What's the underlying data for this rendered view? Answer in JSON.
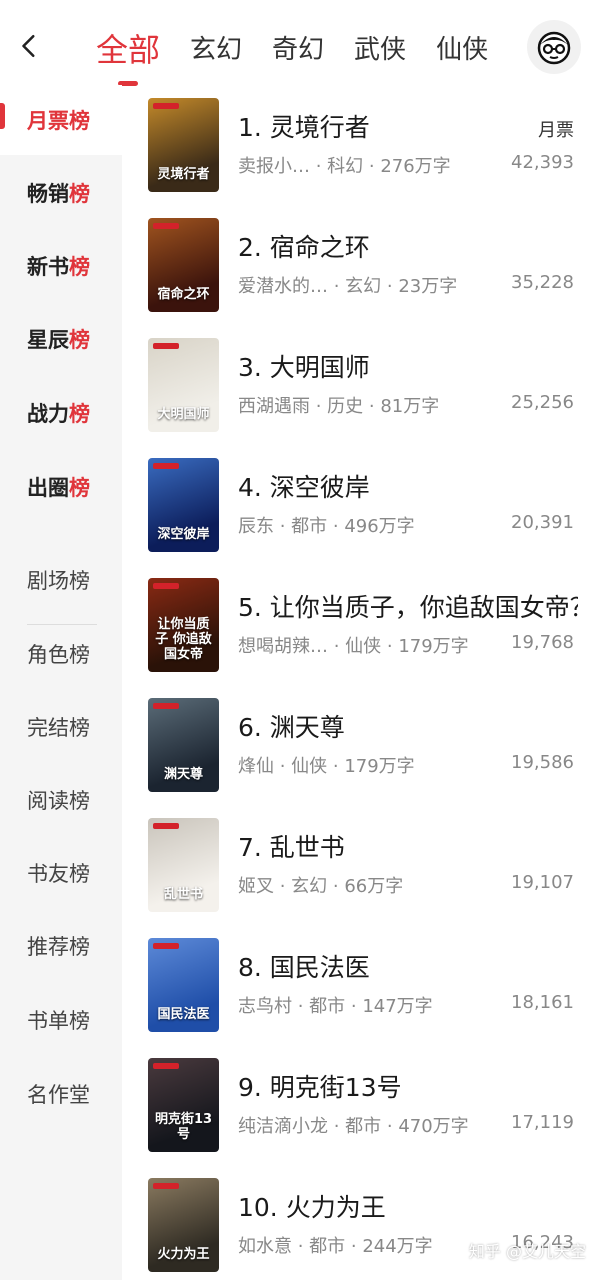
{
  "tabs": [
    "全部",
    "玄幻",
    "奇幻",
    "武侠",
    "仙侠"
  ],
  "sidebar": [
    {
      "label": "月票榜"
    },
    {
      "label": "畅销榜"
    },
    {
      "label": "新书榜"
    },
    {
      "label": "星辰榜"
    },
    {
      "label": "战力榜"
    },
    {
      "label": "出圈榜"
    },
    {
      "label": "剧场榜"
    },
    {
      "label": "角色榜"
    },
    {
      "label": "完结榜"
    },
    {
      "label": "阅读榜"
    },
    {
      "label": "书友榜"
    },
    {
      "label": "推荐榜"
    },
    {
      "label": "书单榜"
    },
    {
      "label": "名作堂"
    }
  ],
  "list": {
    "unit_label": "月票",
    "items": [
      {
        "title": "1. 灵境行者",
        "meta": "卖报小… · 科幻 · 276万字",
        "votes": "42,393",
        "cover": "灵境行者",
        "c1": "#3a2a18",
        "c2": "#c48a2a"
      },
      {
        "title": "2. 宿命之环",
        "meta": "爱潜水的… · 玄幻 · 23万字",
        "votes": "35,228",
        "cover": "宿命之环",
        "c1": "#3b130c",
        "c2": "#a0541f"
      },
      {
        "title": "3. 大明国师",
        "meta": "西湖遇雨 · 历史 · 81万字",
        "votes": "25,256",
        "cover": "大明国师",
        "c1": "#f1efe9",
        "c2": "#d8d3c7"
      },
      {
        "title": "4. 深空彼岸",
        "meta": "辰东 · 都市 · 496万字",
        "votes": "20,391",
        "cover": "深空彼岸",
        "c1": "#0c1d5a",
        "c2": "#3a6cc0"
      },
      {
        "title": "5. 让你当质子，你追敌国女帝？",
        "meta": "想喝胡辣… · 仙侠 · 179万字",
        "votes": "19,768",
        "cover": "让你当质子 你追敌国女帝",
        "c1": "#2a1208",
        "c2": "#8a2a14"
      },
      {
        "title": "6. 渊天尊",
        "meta": "烽仙 · 仙侠 · 179万字",
        "votes": "19,586",
        "cover": "渊天尊",
        "c1": "#1b2430",
        "c2": "#5b6c78"
      },
      {
        "title": "7. 乱世书",
        "meta": "姬叉 · 玄幻 · 66万字",
        "votes": "19,107",
        "cover": "乱世书",
        "c1": "#f4f1ec",
        "c2": "#c9c4bb"
      },
      {
        "title": "8. 国民法医",
        "meta": "志鸟村 · 都市 · 147万字",
        "votes": "18,161",
        "cover": "国民法医",
        "c1": "#1f4ea8",
        "c2": "#5d8ad8"
      },
      {
        "title": "9. 明克街13号",
        "meta": "纯洁滴小龙 · 都市 · 470万字",
        "votes": "17,119",
        "cover": "明克街13号",
        "c1": "#14161c",
        "c2": "#4a3a3e"
      },
      {
        "title": "10. 火力为王",
        "meta": "如水意 · 都市 · 244万字",
        "votes": "16,243",
        "cover": "火力为王",
        "c1": "#2e2a22",
        "c2": "#8a7a60"
      }
    ]
  },
  "watermark": "知乎 @艾儿天空",
  "colors": {
    "accent": "#e0353b",
    "sidebar_bg": "#f5f5f5",
    "meta": "#888888"
  },
  "icons": {
    "back": "chevron-left-icon",
    "avatar": "avatar-icon"
  }
}
